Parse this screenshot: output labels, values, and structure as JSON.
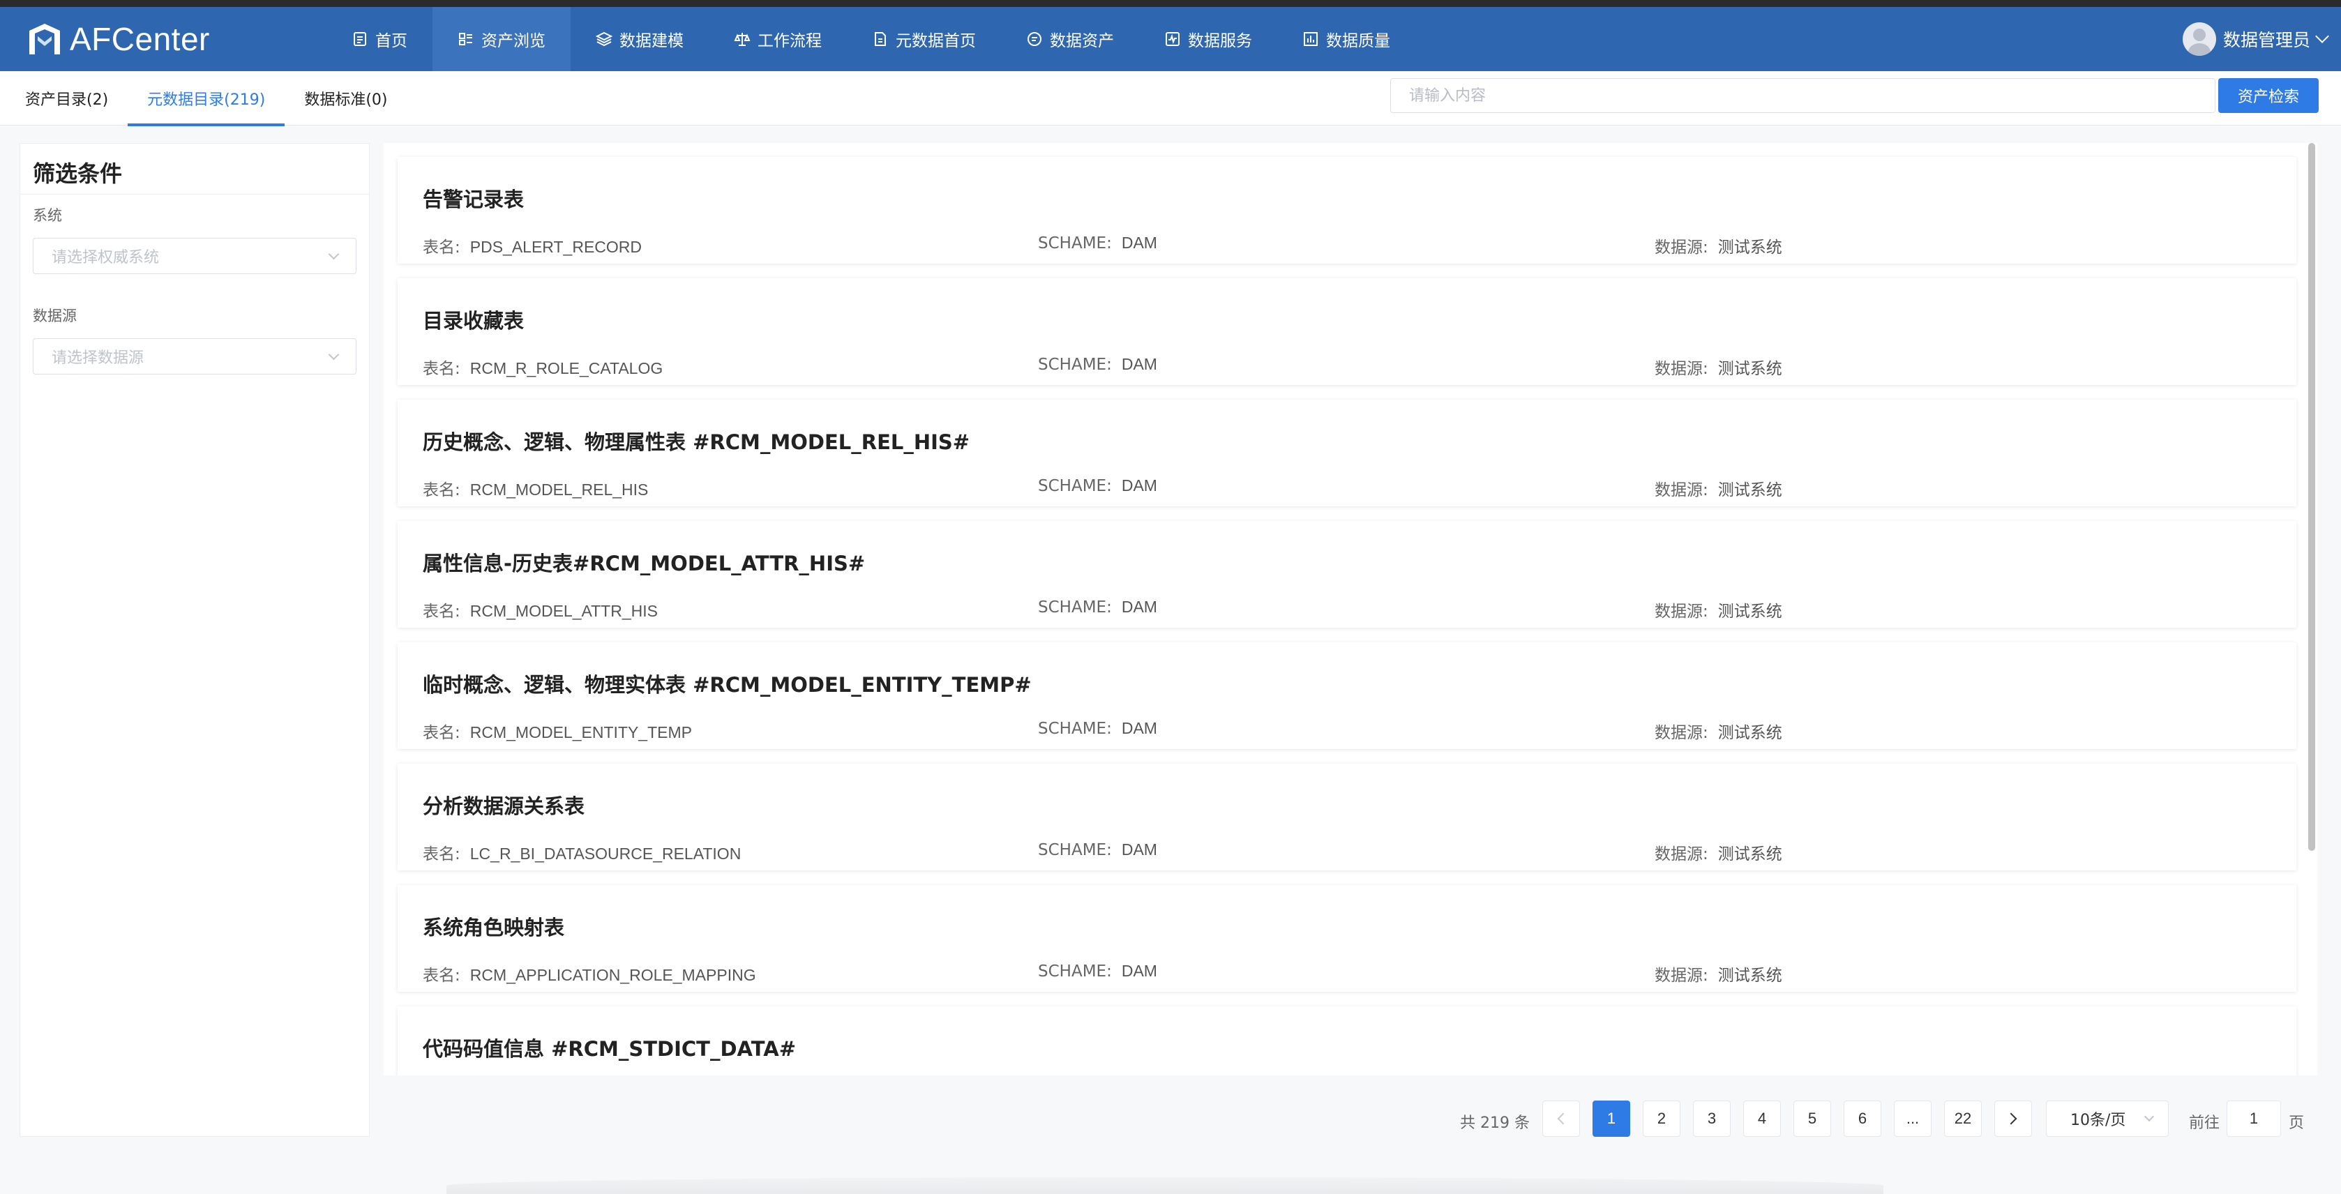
{
  "app": {
    "logo_text": "AFCenter"
  },
  "nav": {
    "items": [
      {
        "label": "首页",
        "icon": "document-icon"
      },
      {
        "label": "资产浏览",
        "icon": "list-icon",
        "active": true
      },
      {
        "label": "数据建模",
        "icon": "layers-icon"
      },
      {
        "label": "工作流程",
        "icon": "balance-icon"
      },
      {
        "label": "元数据首页",
        "icon": "file-edit-icon"
      },
      {
        "label": "数据资产",
        "icon": "chat-icon"
      },
      {
        "label": "数据服务",
        "icon": "pulse-icon"
      },
      {
        "label": "数据质量",
        "icon": "bar-chart-icon"
      }
    ],
    "user_name": "数据管理员"
  },
  "subnav": {
    "tabs": [
      {
        "label": "资产目录(2)"
      },
      {
        "label": "元数据目录(219)",
        "active": true
      },
      {
        "label": "数据标准(0)"
      }
    ],
    "search_placeholder": "请输入内容",
    "search_button": "资产检索"
  },
  "filter": {
    "title": "筛选条件",
    "system_label": "系统",
    "system_placeholder": "请选择权威系统",
    "datasource_label": "数据源",
    "datasource_placeholder": "请选择数据源"
  },
  "meta_labels": {
    "table": "表名:",
    "schema": "SCHAME:",
    "source": "数据源:"
  },
  "records": [
    {
      "title": "告警记录表",
      "table": "PDS_ALERT_RECORD",
      "schema": "DAM",
      "source": "测试系统"
    },
    {
      "title": "目录收藏表",
      "table": "RCM_R_ROLE_CATALOG",
      "schema": "DAM",
      "source": "测试系统"
    },
    {
      "title": "历史概念、逻辑、物理属性表 #RCM_MODEL_REL_HIS#",
      "table": "RCM_MODEL_REL_HIS",
      "schema": "DAM",
      "source": "测试系统"
    },
    {
      "title": "属性信息-历史表#RCM_MODEL_ATTR_HIS#",
      "table": "RCM_MODEL_ATTR_HIS",
      "schema": "DAM",
      "source": "测试系统"
    },
    {
      "title": "临时概念、逻辑、物理实体表 #RCM_MODEL_ENTITY_TEMP#",
      "table": "RCM_MODEL_ENTITY_TEMP",
      "schema": "DAM",
      "source": "测试系统"
    },
    {
      "title": "分析数据源关系表",
      "table": "LC_R_BI_DATASOURCE_RELATION",
      "schema": "DAM",
      "source": "测试系统"
    },
    {
      "title": "系统角色映射表",
      "table": "RCM_APPLICATION_ROLE_MAPPING",
      "schema": "DAM",
      "source": "测试系统"
    },
    {
      "title": "代码码值信息 #RCM_STDICT_DATA#",
      "table": "",
      "schema": "",
      "source": ""
    }
  ],
  "pagination": {
    "total_text": "共 219 条",
    "pages": [
      "1",
      "2",
      "3",
      "4",
      "5",
      "6",
      "...",
      "22"
    ],
    "current": "1",
    "page_size": "10条/页",
    "goto_label": "前往",
    "goto_value": "1",
    "page_suffix": "页"
  },
  "colors": {
    "navbar": "#2f66b0",
    "accent": "#2f7be6"
  }
}
